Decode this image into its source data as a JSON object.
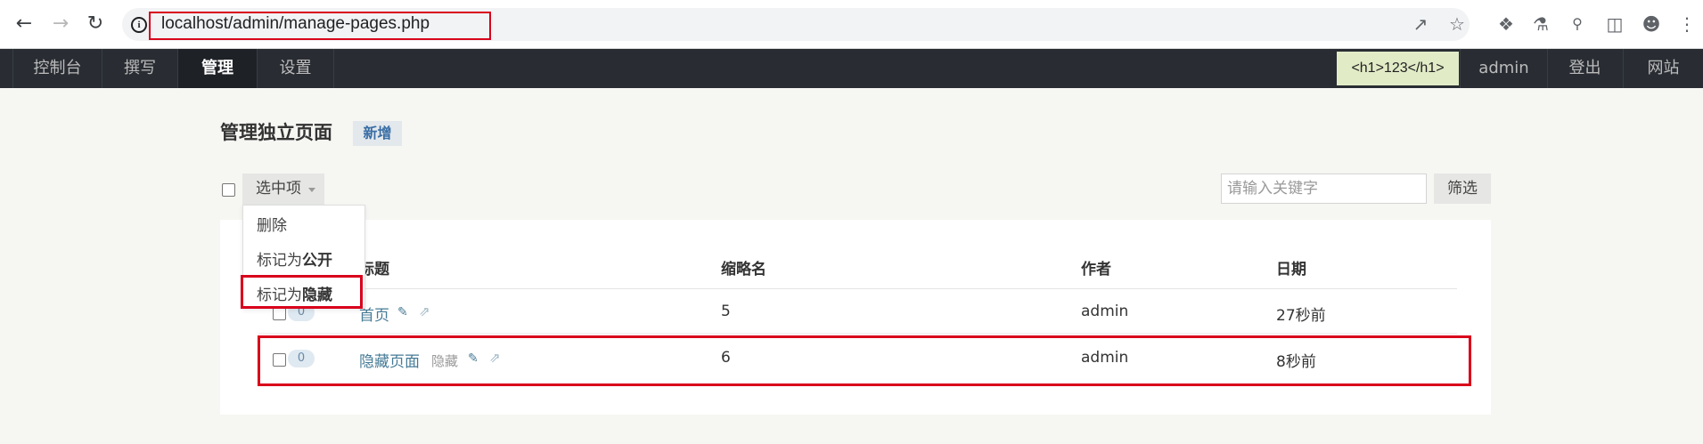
{
  "browser": {
    "url": "localhost/admin/manage-pages.php",
    "icons": [
      "back-arrow",
      "forward-arrow",
      "reload",
      "site-info",
      "share",
      "bookmark-star",
      "extensions",
      "labs-flask",
      "search",
      "side-panel",
      "profile",
      "more-menu"
    ]
  },
  "adminbar": {
    "items": [
      {
        "label": "控制台"
      },
      {
        "label": "撰写"
      },
      {
        "label": "管理",
        "active": true
      },
      {
        "label": "设置"
      }
    ],
    "notice": "<h1>123</h1>",
    "user": "admin",
    "logout": "登出",
    "site": "网站"
  },
  "page": {
    "title": "管理独立页面",
    "add_label": "新增"
  },
  "toolbar": {
    "options_label": "选中项",
    "search_placeholder": "请输入关键字",
    "filter_label": "筛选"
  },
  "dropdown": {
    "delete": "删除",
    "mark_prefix": "标记为",
    "public": "公开",
    "hidden": "隐藏"
  },
  "table": {
    "columns": [
      "标题",
      "缩略名",
      "作者",
      "日期"
    ],
    "rows": [
      {
        "count": "0",
        "title": "首页",
        "status": "",
        "slug": "5",
        "author": "admin",
        "date": "27秒前"
      },
      {
        "count": "0",
        "title": "隐藏页面",
        "status": "隐藏",
        "slug": "6",
        "author": "admin",
        "date": "8秒前"
      }
    ]
  },
  "colors": {
    "adminbar_bg": "#292d33",
    "highlight_red": "#d9001b",
    "link": "#467b96",
    "notice_bg": "#e1ebc6"
  }
}
